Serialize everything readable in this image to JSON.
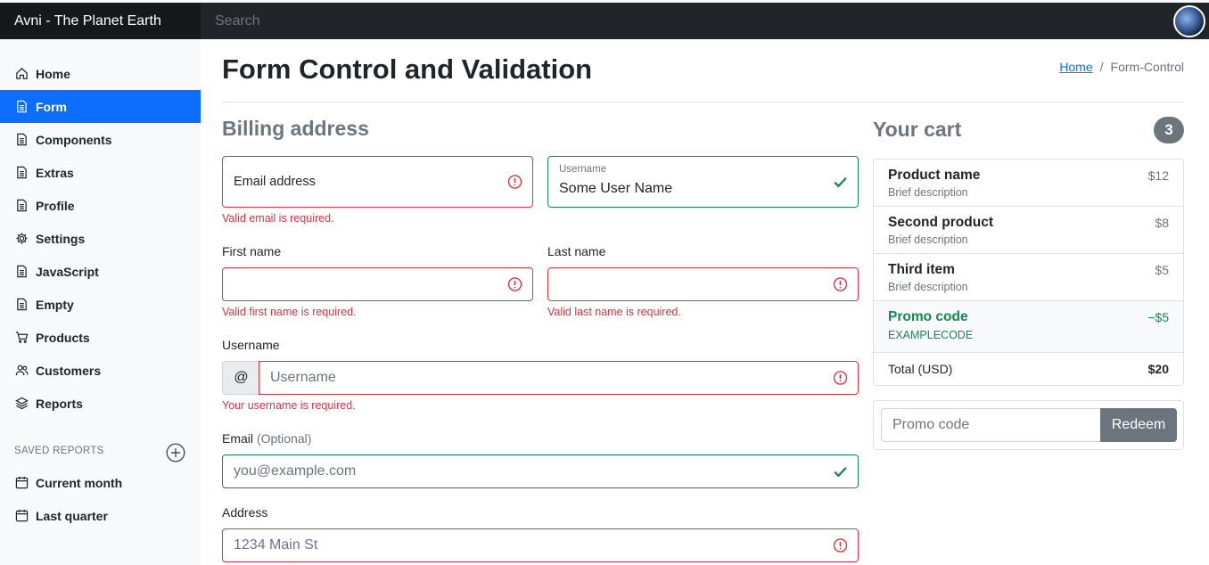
{
  "header": {
    "brand": "Avni - The Planet Earth",
    "search_placeholder": "Search"
  },
  "sidebar": {
    "items": [
      {
        "label": "Home",
        "icon": "home-icon"
      },
      {
        "label": "Form",
        "icon": "file-icon",
        "active": true
      },
      {
        "label": "Components",
        "icon": "file-icon"
      },
      {
        "label": "Extras",
        "icon": "file-icon"
      },
      {
        "label": "Profile",
        "icon": "file-icon"
      },
      {
        "label": "Settings",
        "icon": "gear-icon"
      },
      {
        "label": "JavaScript",
        "icon": "file-icon"
      },
      {
        "label": "Empty",
        "icon": "file-icon"
      },
      {
        "label": "Products",
        "icon": "cart-icon"
      },
      {
        "label": "Customers",
        "icon": "users-icon"
      },
      {
        "label": "Reports",
        "icon": "layers-icon"
      }
    ],
    "saved_reports_heading": "SAVED REPORTS",
    "saved_reports": [
      {
        "label": "Current month",
        "icon": "calendar-icon"
      },
      {
        "label": "Last quarter",
        "icon": "calendar-icon"
      }
    ]
  },
  "main": {
    "title": "Form Control and Validation",
    "breadcrumb": {
      "home": "Home",
      "separator": "/",
      "current": "Form-Control"
    },
    "billing": {
      "title": "Billing address",
      "email_floating_label": "Email address",
      "email_error": "Valid email is required.",
      "username_floating_label": "Username",
      "username_floating_value": "Some User Name",
      "first_name_label": "First name",
      "first_name_error": "Valid first name is required.",
      "last_name_label": "Last name",
      "last_name_error": "Valid last name is required.",
      "username_label": "Username",
      "username_addon": "@",
      "username_placeholder": "Username",
      "username_error": "Your username is required.",
      "email_label": "Email",
      "email_optional": "(Optional)",
      "email_placeholder": "you@example.com",
      "address_label": "Address",
      "address_placeholder": "1234 Main St"
    },
    "cart": {
      "title": "Your cart",
      "count": "3",
      "items": [
        {
          "name": "Product name",
          "desc": "Brief description",
          "price": "$12"
        },
        {
          "name": "Second product",
          "desc": "Brief description",
          "price": "$8"
        },
        {
          "name": "Third item",
          "desc": "Brief description",
          "price": "$5"
        }
      ],
      "promo": {
        "name": "Promo code",
        "code": "EXAMPLECODE",
        "price": "−$5"
      },
      "total_label": "Total (USD)",
      "total_value": "$20",
      "promo_placeholder": "Promo code",
      "redeem_label": "Redeem"
    }
  },
  "colors": {
    "primary": "#0d6efd",
    "danger": "#dc3545",
    "success": "#198754",
    "secondary": "#6c757d",
    "dark": "#212529"
  }
}
